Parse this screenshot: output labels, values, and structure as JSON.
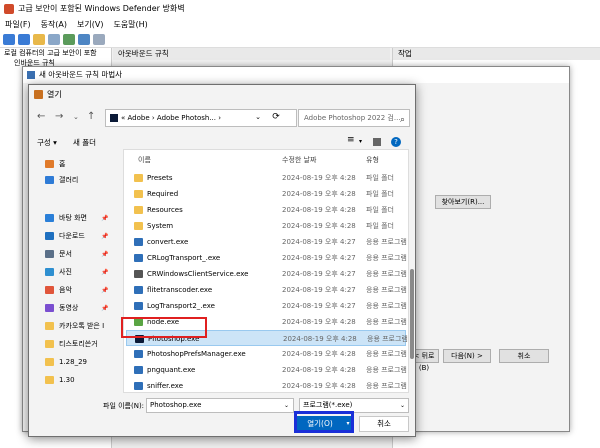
{
  "app": {
    "title": "고급 보안이 포함된 Windows Defender 방화벽",
    "menu": [
      "파일(F)",
      "동작(A)",
      "보기(V)",
      "도움말(H)"
    ],
    "tree": [
      "로컬 컴퓨터의 고급 보안이 포함",
      "인바운드 규칙"
    ],
    "center_header": "아웃바운드 규칙",
    "actions_header": "작업"
  },
  "wizard": {
    "title": "새 아웃바운드 규칙 마법사",
    "browse_label": "찾아보기(R)...",
    "back_label": "< 뒤로(B)",
    "next_label": "다음(N) >",
    "cancel_label": "취소"
  },
  "dialog": {
    "title": "열기",
    "address": "« Adobe  ›  Adobe Photosh...  ›",
    "search_placeholder": "Adobe Photoshop 2022 검...",
    "organize_label": "구성 ▾",
    "new_folder_label": "새 폴더",
    "sidebar": [
      {
        "label": "홈",
        "icon": "home-icon",
        "color": "#e07a2a"
      },
      {
        "label": "갤러리",
        "icon": "gallery-icon",
        "color": "#2e7bd6"
      },
      {
        "label": "바탕 화면",
        "icon": "desktop-icon",
        "color": "#2a7fd8"
      },
      {
        "label": "다운로드",
        "icon": "download-icon",
        "color": "#1e6fbf"
      },
      {
        "label": "문서",
        "icon": "document-icon",
        "color": "#5a6f88"
      },
      {
        "label": "사진",
        "icon": "pictures-icon",
        "color": "#2e8fd0"
      },
      {
        "label": "음악",
        "icon": "music-icon",
        "color": "#e0553a"
      },
      {
        "label": "동영상",
        "icon": "video-icon",
        "color": "#7a4ed0"
      },
      {
        "label": "카카오톡 받은 I",
        "icon": "folder-icon",
        "color": "#f2c14e"
      },
      {
        "label": "티스토리쓴거",
        "icon": "folder-icon",
        "color": "#f2c14e"
      },
      {
        "label": "1.28_29",
        "icon": "folder-icon",
        "color": "#f2c14e"
      },
      {
        "label": "1.30",
        "icon": "folder-icon",
        "color": "#f2c14e"
      }
    ],
    "columns": {
      "name": "이름",
      "date": "수정한 날짜",
      "type": "유형"
    },
    "files": [
      {
        "name": "Presets",
        "date": "2024-08-19 오후 4:28",
        "type": "파일 폴더",
        "kind": "folder"
      },
      {
        "name": "Required",
        "date": "2024-08-19 오후 4:28",
        "type": "파일 폴더",
        "kind": "folder"
      },
      {
        "name": "Resources",
        "date": "2024-08-19 오후 4:28",
        "type": "파일 폴더",
        "kind": "folder"
      },
      {
        "name": "System",
        "date": "2024-08-19 오후 4:28",
        "type": "파일 폴더",
        "kind": "folder"
      },
      {
        "name": "convert.exe",
        "date": "2024-08-19 오후 4:27",
        "type": "응용 프로그램",
        "kind": "exe"
      },
      {
        "name": "CRLogTransport_.exe",
        "date": "2024-08-19 오후 4:27",
        "type": "응용 프로그램",
        "kind": "exe"
      },
      {
        "name": "CRWindowsClientService.exe",
        "date": "2024-08-19 오후 4:27",
        "type": "응용 프로그램",
        "kind": "gear"
      },
      {
        "name": "flitetranscoder.exe",
        "date": "2024-08-19 오후 4:27",
        "type": "응용 프로그램",
        "kind": "exe"
      },
      {
        "name": "LogTransport2_.exe",
        "date": "2024-08-19 오후 4:27",
        "type": "응용 프로그램",
        "kind": "exe"
      },
      {
        "name": "node.exe",
        "date": "2024-08-19 오후 4:28",
        "type": "응용 프로그램",
        "kind": "node"
      },
      {
        "name": "Photoshop.exe",
        "date": "2024-08-19 오후 4:28",
        "type": "응용 프로그램",
        "kind": "ps"
      },
      {
        "name": "PhotoshopPrefsManager.exe",
        "date": "2024-08-19 오후 4:28",
        "type": "응용 프로그램",
        "kind": "exe"
      },
      {
        "name": "pngquant.exe",
        "date": "2024-08-19 오후 4:28",
        "type": "응용 프로그램",
        "kind": "exe"
      },
      {
        "name": "sniffer.exe",
        "date": "2024-08-19 오후 4:28",
        "type": "응용 프로그램",
        "kind": "exe"
      }
    ],
    "selected_file": "Photoshop.exe",
    "filename_label": "파일 이름(N):",
    "filename_value": "Photoshop.exe",
    "filter_value": "프로그램(*.exe)",
    "open_label": "열기(O)",
    "cancel_label": "취소"
  },
  "colors": {
    "accent": "#0067c0",
    "selection": "#cce4f7",
    "highlight_red": "#e02020",
    "highlight_blue": "#1a2fd8",
    "folder": "#f2c14e"
  }
}
